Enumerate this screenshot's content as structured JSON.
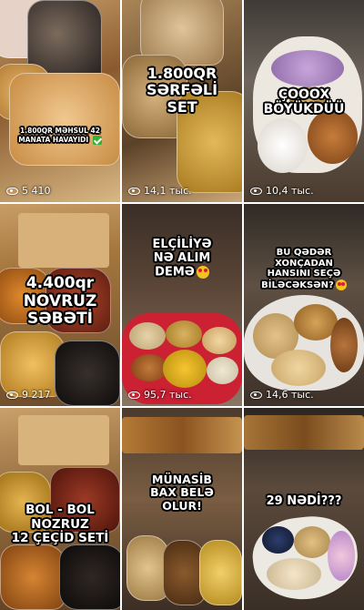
{
  "videos": [
    {
      "caption": "1.800QR MƏHSUL 42 MANATA HAVAYIDI",
      "views": "5 410"
    },
    {
      "caption_lines": [
        "1.800QR",
        "SƏRFƏLİ",
        "SET"
      ],
      "views": "14,1 тыс."
    },
    {
      "caption_lines": [
        "ÇOOOX",
        "BÖYÜKDÜÜ"
      ],
      "views": "10,4 тыс."
    },
    {
      "caption_lines": [
        "4.400qr",
        "NOVRUZ",
        "SƏBƏTİ"
      ],
      "views": "9 217"
    },
    {
      "caption_lines": [
        "ELÇİLİYƏ",
        "NƏ ALIM",
        "DEMƏ"
      ],
      "views": "95,7 тыс."
    },
    {
      "caption_lines": [
        "BU QƏDƏR",
        "XONÇADAN",
        "HANSINI SEÇƏ",
        "BİLƏCƏKSƏN?"
      ],
      "views": "14,6 тыс."
    },
    {
      "caption_lines": [
        "BOL - BOL",
        "NOZRUZ",
        "12 ÇEÇİD SETİ"
      ],
      "views": ""
    },
    {
      "caption_lines": [
        "MÜNASİB",
        "BAX BELƏ",
        "OLUR!"
      ],
      "views": ""
    },
    {
      "caption_lines": [
        "29 NƏDİ???"
      ],
      "views": ""
    }
  ],
  "icons": {
    "views": "eye-icon",
    "emoji": "heart-eyes-emoji-icon",
    "check": "check-mark-icon"
  }
}
